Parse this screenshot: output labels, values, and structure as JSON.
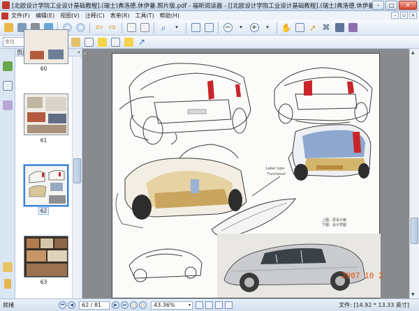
{
  "window": {
    "title": "[北欧设计学院工业设计基础教程].(瑞士)弗洛德.休伊曼.照片版.pdf - 福昕阅读器 - [[北欧设计学院工业设计基础教程].(瑞士)弗洛德.休伊曼.照片...",
    "min": "–",
    "max": "□",
    "close": "✕"
  },
  "menu": {
    "items": [
      "文件(F)",
      "编辑(E)",
      "视图(V)",
      "注释(C)",
      "表单(R)",
      "工具(T)",
      "帮助(H)"
    ],
    "mdi_min": "–",
    "mdi_restore": "▫",
    "mdi_close": "×"
  },
  "toolbar": {
    "search_placeholder": "查找",
    "search_arrow": "▾",
    "zoom_out": "−",
    "zoom_in": "+"
  },
  "panel": {
    "title": "页面",
    "collapse": "«",
    "thumbnails": [
      {
        "label": "60",
        "selected": false
      },
      {
        "label": "61",
        "selected": false
      },
      {
        "label": "62",
        "selected": true
      },
      {
        "label": "63",
        "selected": false
      }
    ]
  },
  "document": {
    "collapse": "›",
    "date_stamp": "2007 10 2",
    "caption_1": "上图：原设计稿",
    "caption_2": "下图：设计草图",
    "sketch_note_1": "Label type",
    "sketch_note_2": "Functional"
  },
  "status": {
    "ready": "就绪",
    "page_value": "62 / 81",
    "zoom_value": "43.36%",
    "file_size": "文件: [14.92 * 13.33 英寸]"
  },
  "colors": {
    "accent": "#3d82d6",
    "doc_background": "#888a8d",
    "date_stamp": "#e4530f",
    "sketch_red": "#c8262b"
  }
}
